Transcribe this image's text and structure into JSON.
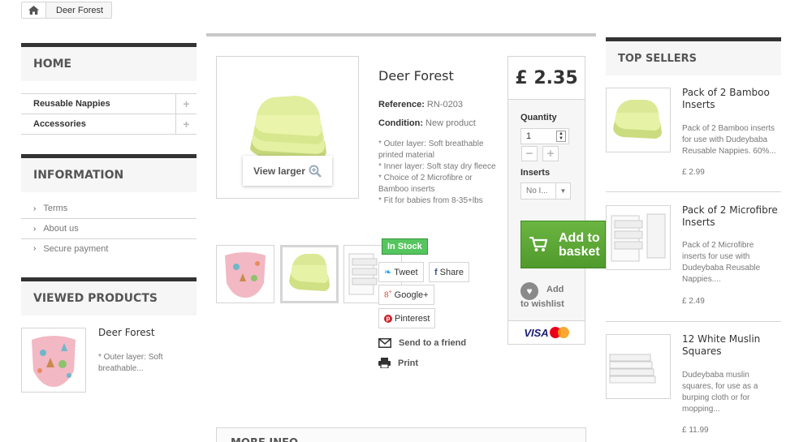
{
  "breadcrumb": {
    "current": "Deer Forest"
  },
  "left": {
    "home_title": "HOME",
    "categories": [
      {
        "label": "Reusable Nappies"
      },
      {
        "label": "Accessories"
      }
    ],
    "info_title": "INFORMATION",
    "info_links": [
      {
        "label": "Terms"
      },
      {
        "label": "About us"
      },
      {
        "label": "Secure payment"
      }
    ],
    "viewed_title": "VIEWED PRODUCTS",
    "viewed": {
      "name": "Deer Forest",
      "desc": "* Outer layer: Soft breathable..."
    }
  },
  "product": {
    "title": "Deer Forest",
    "reference_label": "Reference:",
    "reference": "RN-0203",
    "condition_label": "Condition:",
    "condition": "New product",
    "desc_lines": [
      "* Outer layer: Soft breathable printed material",
      "* Inner layer: Soft stay dry fleece",
      "* Choice of 2 Microfibre or Bamboo inserts",
      "* Fit for babies from 8-35+lbs"
    ],
    "view_larger": "View larger",
    "stock": "In Stock",
    "tweet": "Tweet",
    "share": "Share",
    "google": "Google+",
    "pinterest": "Pinterest",
    "send_friend": "Send to a friend",
    "print": "Print",
    "more_info": "MORE INFO"
  },
  "buy": {
    "price": "£ 2.35",
    "quantity_label": "Quantity",
    "quantity_value": "1",
    "inserts_label": "Inserts",
    "inserts_value": "No I...",
    "add_basket": "Add to basket",
    "wishlist": "Add to wishlist",
    "visa": "VISA"
  },
  "top_sellers": {
    "title": "TOP SELLERS",
    "items": [
      {
        "name": "Pack of 2 Bamboo Inserts",
        "desc": "Pack of 2 Bamboo inserts for use with Dudeybaba Reusable Nappies. 60%...",
        "price": "£ 2.99"
      },
      {
        "name": "Pack of 2 Microfibre Inserts",
        "desc": "Pack of 2 Microfibre inserts for use with Dudeybaba Reusable Nappies....",
        "price": "£ 2.49"
      },
      {
        "name": "12 White Muslin Squares",
        "desc": "Dudeybaba muslin squares, for use as a burping cloth or for mopping...",
        "price": "£ 11.99"
      }
    ]
  },
  "colors": {
    "accent": "#333333",
    "green_button": "#5ea336",
    "stock_green": "#55c65e",
    "twitter": "#1da1f2",
    "google": "#dd4b39",
    "pinterest": "#cb2027"
  }
}
